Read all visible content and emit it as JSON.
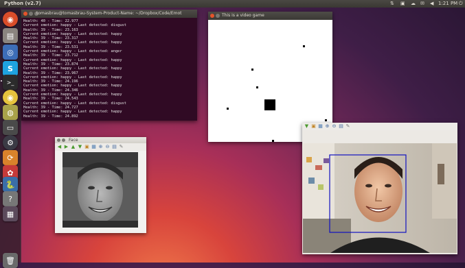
{
  "topbar": {
    "app_title": "Python (v2.7)",
    "clock": "1:21 PM"
  },
  "launcher": {
    "icons": [
      "dash-icon",
      "files-icon",
      "browser-icon",
      "skype-icon",
      "terminal-icon",
      "chrome-icon",
      "settings-icon",
      "screen-icon",
      "steam-icon",
      "update-icon",
      "app-icon",
      "python-icon",
      "system-icon",
      "workspace-icon",
      "trash-icon"
    ]
  },
  "terminal": {
    "title": "tomasbrau@tomasbrau-System-Product-Name: ~/Dropbox/Code/Emot",
    "lines": [
      "Health: 40 - Time: 22.977",
      "Current emotion: happy - Last detected: disgust",
      "Health: 39 - Time: 23.163",
      "Current emotion: happy - Last detected: happy",
      "Health: 39 - Time: 23.317",
      "Current emotion: happy - Last detected: happy",
      "Health: 39 - Time: 23.531",
      "Current emotion: happy - Last detected: anger",
      "Health: 39 - Time: 23.712",
      "Current emotion: happy - Last detected: happy",
      "Health: 39 - Time: 23.874",
      "Current emotion: happy - Last detected: happy",
      "Health: 39 - Time: 23.967",
      "Current emotion: happy - Last detected: happy",
      "Health: 39 - Time: 24.196",
      "Current emotion: happy - Last detected: happy",
      "Health: 39 - Time: 24.346",
      "Current emotion: happy - Last detected: happy",
      "Health: 39 - Time: 24.543",
      "Current emotion: happy - Last detected: disgust",
      "Health: 39 - Time: 24.727",
      "Current emotion: happy - Last detected: happy",
      "Health: 39 - Time: 24.892"
    ]
  },
  "game": {
    "title": "This is a video game"
  },
  "face_window": {
    "title": "Face"
  },
  "toolbar_icons": [
    "back-icon",
    "forward-icon",
    "up-icon",
    "down-icon",
    "save-icon",
    "grid-icon",
    "zoom-in-icon",
    "zoom-out-icon",
    "save-as-icon",
    "edit-icon"
  ],
  "colors": {
    "terminal_bg": "#300a24",
    "close_button": "#e5542b",
    "face_box": "#1010c0"
  }
}
